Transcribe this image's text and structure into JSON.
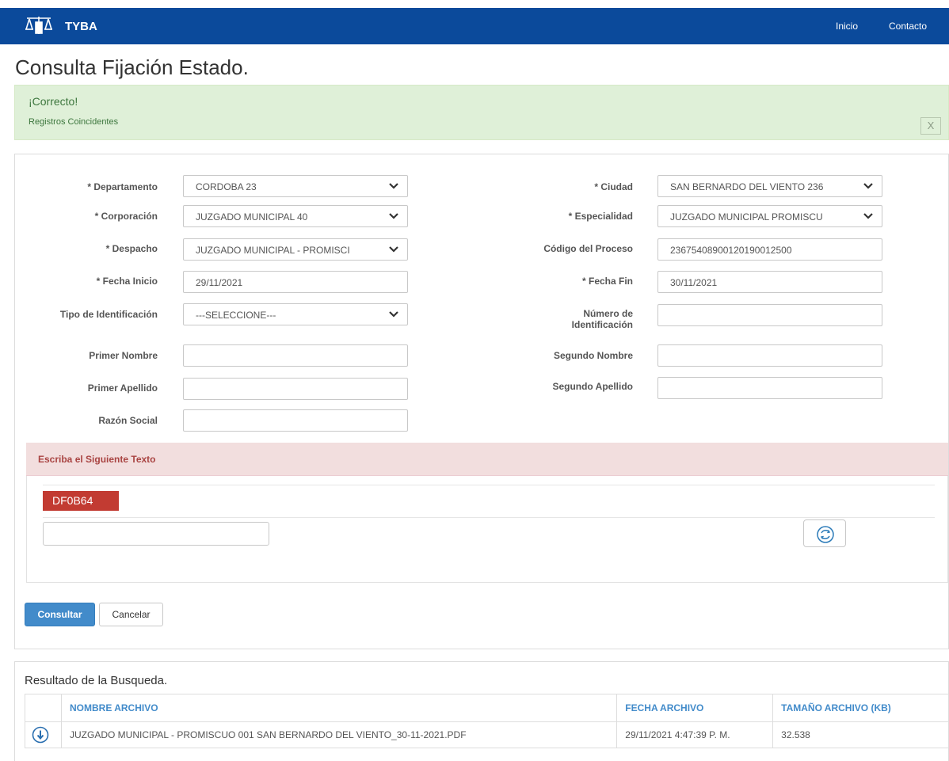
{
  "navbar": {
    "brand": "TYBA",
    "links": [
      "Inicio",
      "Contacto"
    ]
  },
  "page": {
    "title": "Consulta Fijación Estado."
  },
  "alert": {
    "title": "¡Correcto!",
    "text": "Registros Coincidentes",
    "close_label": "X"
  },
  "form": {
    "departamento": {
      "label": "* Departamento",
      "value": "CORDOBA 23"
    },
    "ciudad": {
      "label": "* Ciudad",
      "value": "SAN BERNARDO DEL VIENTO 236"
    },
    "corporacion": {
      "label": "* Corporación",
      "value": "JUZGADO MUNICIPAL 40"
    },
    "especialidad": {
      "label": "* Especialidad",
      "value": "JUZGADO MUNICIPAL PROMISCU"
    },
    "despacho": {
      "label": "* Despacho",
      "value": "JUZGADO MUNICIPAL - PROMISCI"
    },
    "codigo_proceso": {
      "label": "Código del Proceso",
      "value": "23675408900120190012500"
    },
    "fecha_inicio": {
      "label": "* Fecha Inicio",
      "value": "29/11/2021"
    },
    "fecha_fin": {
      "label": "* Fecha Fin",
      "value": "30/11/2021"
    },
    "tipo_identificacion": {
      "label": "Tipo de Identificación",
      "value": "---SELECCIONE---"
    },
    "numero_identificacion": {
      "label_line1": "Número de",
      "label_line2": "Identificación",
      "value": ""
    },
    "primer_nombre": {
      "label": "Primer Nombre",
      "value": ""
    },
    "segundo_nombre": {
      "label": "Segundo Nombre",
      "value": ""
    },
    "primer_apellido": {
      "label": "Primer Apellido",
      "value": ""
    },
    "segundo_apellido": {
      "label": "Segundo Apellido",
      "value": ""
    },
    "razon_social": {
      "label": "Razón Social",
      "value": ""
    }
  },
  "captcha": {
    "heading": "Escriba el Siguiente Texto",
    "code": "DF0B64",
    "input_value": ""
  },
  "buttons": {
    "consultar": "Consultar",
    "cancelar": "Cancelar"
  },
  "results": {
    "title": "Resultado de la Busqueda.",
    "columns": [
      "NOMBRE ARCHIVO",
      "FECHA ARCHIVO",
      "TAMAÑO ARCHIVO (KB)"
    ],
    "rows": [
      {
        "nombre": "JUZGADO MUNICIPAL - PROMISCUO 001 SAN BERNARDO DEL VIENTO_30-11-2021.PDF",
        "fecha": "29/11/2021 4:47:39 P. M.",
        "tamano": "32.538"
      }
    ]
  },
  "colors": {
    "navbar": "#0b4a9b",
    "alert_bg": "#dff0d8",
    "captcha_head_bg": "#f2dede",
    "primary": "#428bca",
    "captcha_code_bg": "#c23b32"
  },
  "icons": [
    "scales-logo-icon",
    "chevron-down-icon",
    "refresh-icon",
    "download-icon"
  ]
}
